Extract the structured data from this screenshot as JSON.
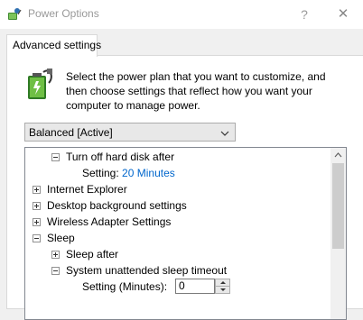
{
  "window": {
    "title": "Power Options",
    "help_glyph": "?",
    "close_glyph": "✕"
  },
  "tab": {
    "label": "Advanced settings"
  },
  "description": "Select the power plan that you want to customize, and then choose settings that reflect how you want your computer to manage power.",
  "plan_select": {
    "value": "Balanced [Active]"
  },
  "tree": {
    "turn_off_hard_disk": "Turn off hard disk after",
    "hard_disk_setting_label": "Setting:",
    "hard_disk_setting_value": "20 Minutes",
    "internet_explorer": "Internet Explorer",
    "desktop_background": "Desktop background settings",
    "wireless_adapter": "Wireless Adapter Settings",
    "sleep": "Sleep",
    "sleep_after": "Sleep after",
    "unattended_timeout": "System unattended sleep timeout",
    "minutes_label": "Setting (Minutes):",
    "minutes_value": "0"
  }
}
